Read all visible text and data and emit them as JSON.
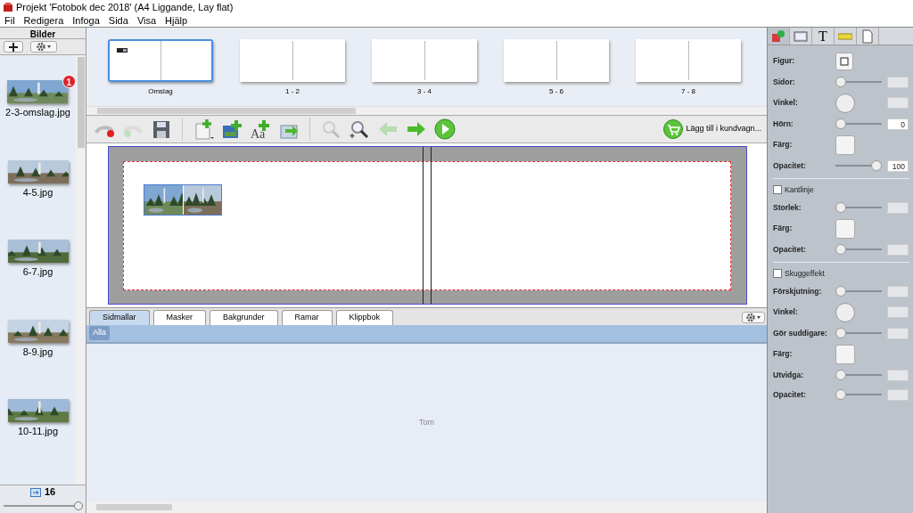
{
  "window": {
    "title": "Projekt 'Fotobok dec 2018' (A4 Liggande, Lay flat)"
  },
  "menu": [
    "Fil",
    "Redigera",
    "Infoga",
    "Sida",
    "Visa",
    "Hjälp"
  ],
  "images_panel": {
    "title": "Bilder",
    "items": [
      {
        "label": "2-3-omslag.jpg",
        "badge": "1"
      },
      {
        "label": "4-5.jpg"
      },
      {
        "label": "6-7.jpg"
      },
      {
        "label": "8-9.jpg"
      },
      {
        "label": "10-11.jpg"
      }
    ],
    "count": "16",
    "zoom": {
      "level": 0.95
    }
  },
  "pages": [
    {
      "label": "Omslag",
      "selected": true
    },
    {
      "label": "1 - 2",
      "selected": false
    },
    {
      "label": "3 - 4",
      "selected": false
    },
    {
      "label": "5 - 6",
      "selected": false
    },
    {
      "label": "7 - 8",
      "selected": false
    }
  ],
  "toolbar": [
    {
      "kind": "undo",
      "disabled": false
    },
    {
      "kind": "redo",
      "disabled": true
    },
    {
      "kind": "save",
      "disabled": false
    },
    {
      "kind": "sep"
    },
    {
      "kind": "new-page",
      "disabled": false
    },
    {
      "kind": "add-image",
      "disabled": false
    },
    {
      "kind": "add-text",
      "disabled": false,
      "glyph": "Aa"
    },
    {
      "kind": "export",
      "disabled": false
    },
    {
      "kind": "sep"
    },
    {
      "kind": "zoom-out",
      "disabled": true
    },
    {
      "kind": "zoom-in",
      "disabled": false
    },
    {
      "kind": "back",
      "disabled": true
    },
    {
      "kind": "forward",
      "disabled": false
    },
    {
      "kind": "play",
      "disabled": false
    }
  ],
  "cart_button": "Lägg till i kundvagn...",
  "bottom_tabs": [
    {
      "label": "Sidmallar",
      "selected": true
    },
    {
      "label": "Masker",
      "selected": false
    },
    {
      "label": "Bakgrunder",
      "selected": false
    },
    {
      "label": "Ramar",
      "selected": false
    },
    {
      "label": "Klippbok",
      "selected": false
    }
  ],
  "filter": "Alla",
  "empty_text": "Tom",
  "properties": {
    "tabs": [
      {
        "kind": "shape",
        "selected": true
      },
      {
        "kind": "frame",
        "selected": false
      },
      {
        "kind": "text",
        "selected": false,
        "glyph": "T"
      },
      {
        "kind": "ruler",
        "selected": false
      },
      {
        "kind": "page",
        "selected": false
      }
    ],
    "rows": [
      {
        "kind": "shape",
        "label": "Figur:"
      },
      {
        "kind": "slider",
        "label": "Sidor:",
        "level": 0
      },
      {
        "kind": "dial",
        "label": "Vinkel:"
      },
      {
        "kind": "slider",
        "label": "Hörn:",
        "level": 0,
        "value": "0"
      },
      {
        "kind": "swatch",
        "label": "Färg:"
      },
      {
        "kind": "slider",
        "label": "Opacitet:",
        "level": 1,
        "value": "100"
      },
      {
        "kind": "check",
        "label": "Kantlinje",
        "checked": false
      },
      {
        "kind": "slider",
        "label": "Storlek:",
        "level": 0
      },
      {
        "kind": "swatch",
        "label": "Färg:"
      },
      {
        "kind": "slider",
        "label": "Opacitet:",
        "level": 0
      },
      {
        "kind": "check",
        "label": "Skuggeffekt",
        "checked": false
      },
      {
        "kind": "slider",
        "label": "Förskjutning:",
        "level": 0
      },
      {
        "kind": "dial",
        "label": "Vinkel:"
      },
      {
        "kind": "slider",
        "label": "Gör suddigare:",
        "level": 0
      },
      {
        "kind": "swatch",
        "label": "Färg:"
      },
      {
        "kind": "slider",
        "label": "Utvidga:",
        "level": 0
      },
      {
        "kind": "slider",
        "label": "Opacitet:",
        "level": 0
      }
    ]
  }
}
